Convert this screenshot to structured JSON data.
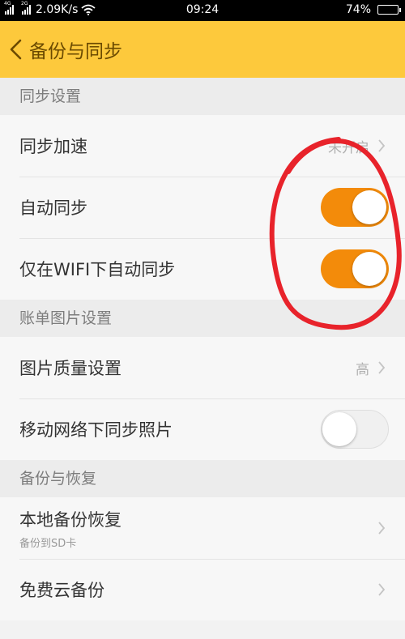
{
  "status_bar": {
    "signal1_tag": "4G",
    "signal2_tag": "2G",
    "speed": "2.09K/s",
    "time": "09:24",
    "battery": "74%",
    "battery_level": 0.74
  },
  "header": {
    "title": "备份与同步",
    "bg_color": "#fdc93c"
  },
  "sections": [
    {
      "title": "同步设置",
      "rows": [
        {
          "label": "同步加速",
          "value": "未开启"
        },
        {
          "label": "自动同步",
          "toggle": true
        },
        {
          "label": "仅在WIFI下自动同步",
          "toggle": true
        }
      ]
    },
    {
      "title": "账单图片设置",
      "rows": [
        {
          "label": "图片质量设置",
          "value": "高"
        },
        {
          "label": "移动网络下同步照片",
          "toggle": false
        }
      ]
    },
    {
      "title": "备份与恢复",
      "rows": [
        {
          "label": "本地备份恢复",
          "sublabel": "备份到SD卡"
        },
        {
          "label": "免费云备份"
        }
      ]
    }
  ],
  "colors": {
    "accent_orange": "#f38b0a",
    "annotation_red": "#e8232b"
  }
}
